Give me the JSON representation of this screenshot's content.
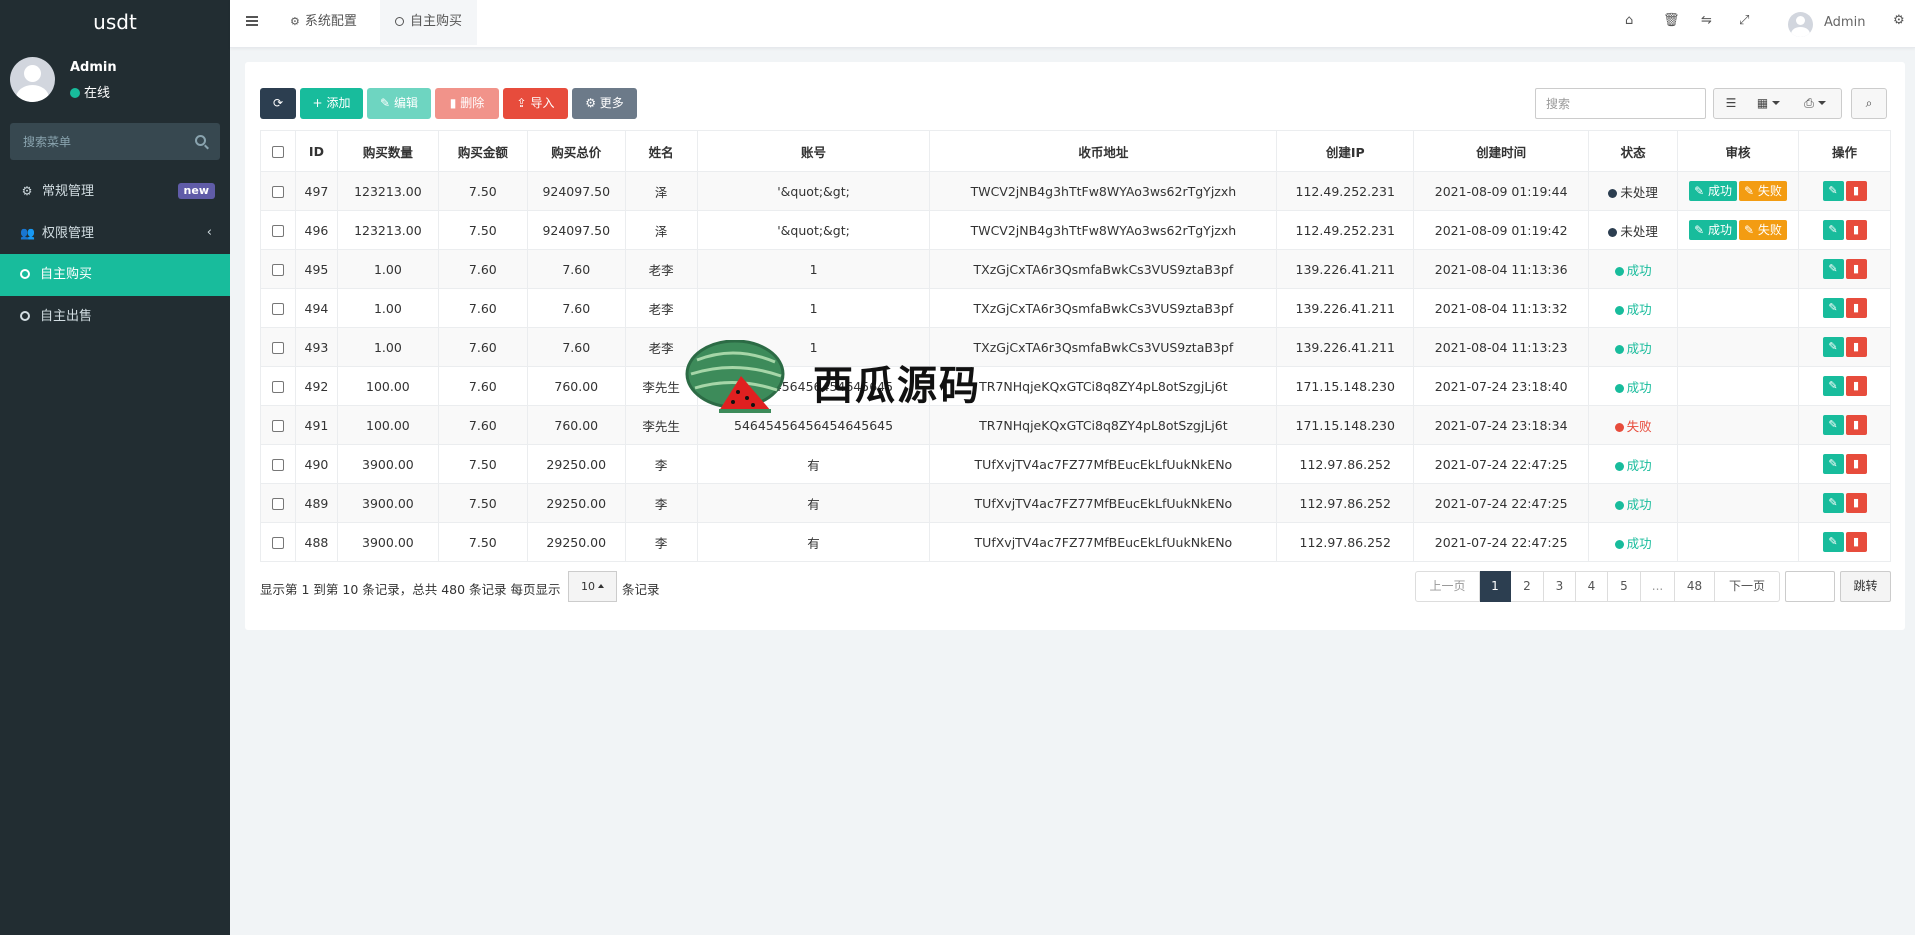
{
  "sidebar": {
    "brand": "usdt",
    "user_name": "Admin",
    "user_status": "在线",
    "search_placeholder": "搜索菜单",
    "items": [
      {
        "label": "常规管理",
        "badge": "new"
      },
      {
        "label": "权限管理"
      },
      {
        "label": "自主购买"
      },
      {
        "label": "自主出售"
      }
    ]
  },
  "header": {
    "tabs": [
      {
        "label": "系统配置"
      },
      {
        "label": "自主购买"
      }
    ],
    "user": "Admin"
  },
  "toolbar": {
    "add": "添加",
    "edit": "编辑",
    "delete": "删除",
    "import": "导入",
    "more": "更多",
    "search_placeholder": "搜索"
  },
  "table": {
    "columns": [
      "ID",
      "购买数量",
      "购买金额",
      "购买总价",
      "姓名",
      "账号",
      "收币地址",
      "创建IP",
      "创建时间",
      "状态",
      "审核",
      "操作"
    ],
    "review_success": "成功",
    "review_fail": "失败",
    "rows": [
      {
        "id": "497",
        "qty": "123213.00",
        "price": "7.50",
        "total": "924097.50",
        "name": "泽",
        "account": "'&quot;&gt;",
        "address": "TWCV2jNB4g3hTtFw8WYAo3ws62rTgYjzxh",
        "ip": "112.49.252.231",
        "time": "2021-08-09 01:19:44",
        "status": "未处理"
      },
      {
        "id": "496",
        "qty": "123213.00",
        "price": "7.50",
        "total": "924097.50",
        "name": "泽",
        "account": "'&quot;&gt;",
        "address": "TWCV2jNB4g3hTtFw8WYAo3ws62rTgYjzxh",
        "ip": "112.49.252.231",
        "time": "2021-08-09 01:19:42",
        "status": "未处理"
      },
      {
        "id": "495",
        "qty": "1.00",
        "price": "7.60",
        "total": "7.60",
        "name": "老李",
        "account": "1",
        "address": "TXzGjCxTA6r3QsmfaBwkCs3VUS9ztaB3pf",
        "ip": "139.226.41.211",
        "time": "2021-08-04 11:13:36",
        "status": "成功"
      },
      {
        "id": "494",
        "qty": "1.00",
        "price": "7.60",
        "total": "7.60",
        "name": "老李",
        "account": "1",
        "address": "TXzGjCxTA6r3QsmfaBwkCs3VUS9ztaB3pf",
        "ip": "139.226.41.211",
        "time": "2021-08-04 11:13:32",
        "status": "成功"
      },
      {
        "id": "493",
        "qty": "1.00",
        "price": "7.60",
        "total": "7.60",
        "name": "老李",
        "account": "1",
        "address": "TXzGjCxTA6r3QsmfaBwkCs3VUS9ztaB3pf",
        "ip": "139.226.41.211",
        "time": "2021-08-04 11:13:23",
        "status": "成功"
      },
      {
        "id": "492",
        "qty": "100.00",
        "price": "7.60",
        "total": "760.00",
        "name": "李先生",
        "account": "54645456456454645645",
        "address": "TR7NHqjeKQxGTCi8q8ZY4pL8otSzgjLj6t",
        "ip": "171.15.148.230",
        "time": "2021-07-24 23:18:40",
        "status": "成功"
      },
      {
        "id": "491",
        "qty": "100.00",
        "price": "7.60",
        "total": "760.00",
        "name": "李先生",
        "account": "54645456456454645645",
        "address": "TR7NHqjeKQxGTCi8q8ZY4pL8otSzgjLj6t",
        "ip": "171.15.148.230",
        "time": "2021-07-24 23:18:34",
        "status": "失败"
      },
      {
        "id": "490",
        "qty": "3900.00",
        "price": "7.50",
        "total": "29250.00",
        "name": "李",
        "account": "有",
        "address": "TUfXvjTV4ac7FZ77MfBEucEkLfUukNkENo",
        "ip": "112.97.86.252",
        "time": "2021-07-24 22:47:25",
        "status": "成功"
      },
      {
        "id": "489",
        "qty": "3900.00",
        "price": "7.50",
        "total": "29250.00",
        "name": "李",
        "account": "有",
        "address": "TUfXvjTV4ac7FZ77MfBEucEkLfUukNkENo",
        "ip": "112.97.86.252",
        "time": "2021-07-24 22:47:25",
        "status": "成功"
      },
      {
        "id": "488",
        "qty": "3900.00",
        "price": "7.50",
        "total": "29250.00",
        "name": "李",
        "account": "有",
        "address": "TUfXvjTV4ac7FZ77MfBEucEkLfUukNkENo",
        "ip": "112.97.86.252",
        "time": "2021-07-24 22:47:25",
        "status": "成功"
      }
    ]
  },
  "pagination": {
    "info": "显示第 1 到第 10 条记录，总共 480 条记录 每页显示",
    "page_size": "10",
    "suffix": "条记录",
    "prev": "上一页",
    "pages": [
      "1",
      "2",
      "3",
      "4",
      "5",
      "...",
      "48"
    ],
    "next": "下一页",
    "jump": "跳转"
  },
  "watermark": {
    "text": "西瓜源码"
  },
  "colors": {
    "sidebar_bg": "#222d32",
    "accent": "#18bc9c",
    "danger": "#e74c3c",
    "warning": "#f39c12",
    "dark": "#2c3e50",
    "badge": "#605ca8"
  }
}
